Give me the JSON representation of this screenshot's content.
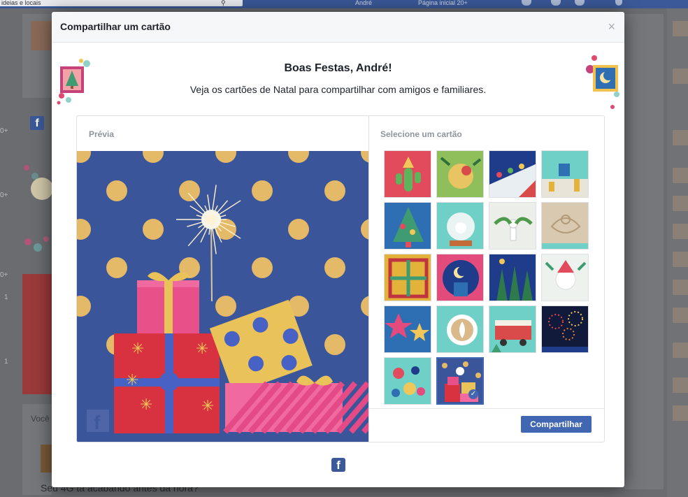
{
  "background": {
    "search_text": "ideias e locais",
    "user_name": "André",
    "home_label": "Página inicial  20+",
    "voce_text": "Você",
    "post_text": "Seu 4G tá acabando antes da hora?",
    "side_numbers": [
      "0+",
      "0+",
      "0+",
      "1",
      "1"
    ]
  },
  "modal": {
    "title": "Compartilhar um cartão",
    "close": "×",
    "greeting_title": "Boas Festas, André!",
    "greeting_subtitle": "Veja os cartões de Natal para compartilhar com amigos e familiares.",
    "preview_label": "Prévia",
    "select_label": "Selecione um cartão",
    "share_button": "Compartilhar",
    "facebook_logo": "f"
  },
  "cards": [
    {
      "name": "card-cactus",
      "selected": false
    },
    {
      "name": "card-bird",
      "selected": false
    },
    {
      "name": "card-lights",
      "selected": false
    },
    {
      "name": "card-dreidel",
      "selected": false
    },
    {
      "name": "card-tree-ornaments",
      "selected": false
    },
    {
      "name": "card-snow-globe",
      "selected": false
    },
    {
      "name": "card-angel-leaves",
      "selected": false
    },
    {
      "name": "card-sand-angel",
      "selected": false
    },
    {
      "name": "card-pattern",
      "selected": false
    },
    {
      "name": "card-crescent-moon",
      "selected": false
    },
    {
      "name": "card-forest",
      "selected": false
    },
    {
      "name": "card-santa",
      "selected": false
    },
    {
      "name": "card-stars",
      "selected": false
    },
    {
      "name": "card-latte",
      "selected": false
    },
    {
      "name": "card-bus",
      "selected": false
    },
    {
      "name": "card-fireworks",
      "selected": false
    },
    {
      "name": "card-ornaments",
      "selected": false
    },
    {
      "name": "card-gifts",
      "selected": true
    }
  ],
  "colors": {
    "brand_blue": "#4267b2",
    "facebook_blue": "#3b5998",
    "preview_bg": "#3b559a",
    "polka_dot": "#e4b968"
  }
}
